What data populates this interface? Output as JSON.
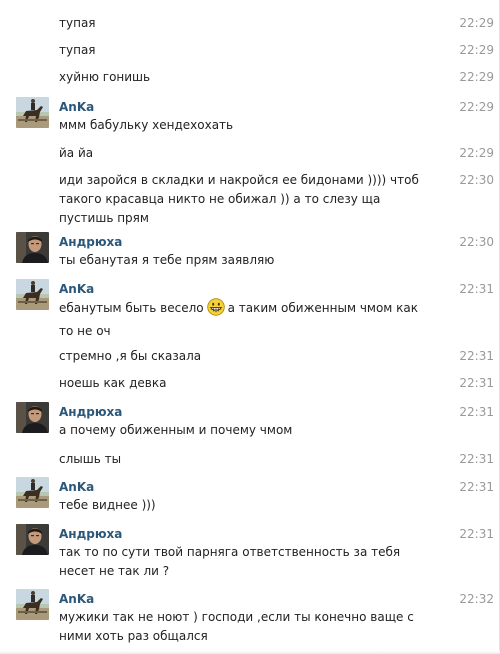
{
  "messages": [
    {
      "text": "тупая",
      "time": "22:29"
    },
    {
      "text": "тупая",
      "time": "22:29"
    },
    {
      "text": "хуйню гонишь",
      "time": "22:29"
    },
    {
      "author": "AnKa",
      "avatar": "horse-rider-avatar",
      "text": "ммм бабульку хендехохать",
      "time": "22:29"
    },
    {
      "text": "йа йа",
      "time": "22:29"
    },
    {
      "text": "иди заройся в складки и накройся ее бидонами )))) чтоб такого красавца никто не обижал )) а то слезу ща пустишь прям",
      "time": "22:30"
    },
    {
      "author": "Андрюха",
      "avatar": "man-portrait-avatar",
      "text": "ты ебанутая я тебе прям заявляю",
      "time": "22:30"
    },
    {
      "author": "AnKa",
      "avatar": "horse-rider-avatar",
      "text_before": "ебанутым быть весело",
      "emoji": "grinning-face-emoji",
      "text_after": "а таким обиженным чмом как то не оч",
      "time": "22:31"
    },
    {
      "text": "стремно ,я бы сказала",
      "time": "22:31"
    },
    {
      "text": "ноешь как девка",
      "time": "22:31"
    },
    {
      "author": "Андрюха",
      "avatar": "man-portrait-avatar",
      "text": "а почему обиженным и почему чмом",
      "time": "22:31"
    },
    {
      "text": "слышь ты",
      "time": "22:31"
    },
    {
      "author": "AnKa",
      "avatar": "horse-rider-avatar",
      "text": "тебе виднее )))",
      "time": "22:31"
    },
    {
      "author": "Андрюха",
      "avatar": "man-portrait-avatar",
      "text": "так то по сути твой парняга ответственность за тебя несет не так ли ?",
      "time": "22:31"
    },
    {
      "author": "AnKa",
      "avatar": "horse-rider-avatar",
      "text": "мужики так не ноют ) господи ,если ты конечно ваще с ними хоть раз общался",
      "time": "22:32"
    }
  ],
  "colors": {
    "author_name": "#2b587a",
    "timestamp": "#999999",
    "message_text": "#222222",
    "background": "#ffffff"
  }
}
